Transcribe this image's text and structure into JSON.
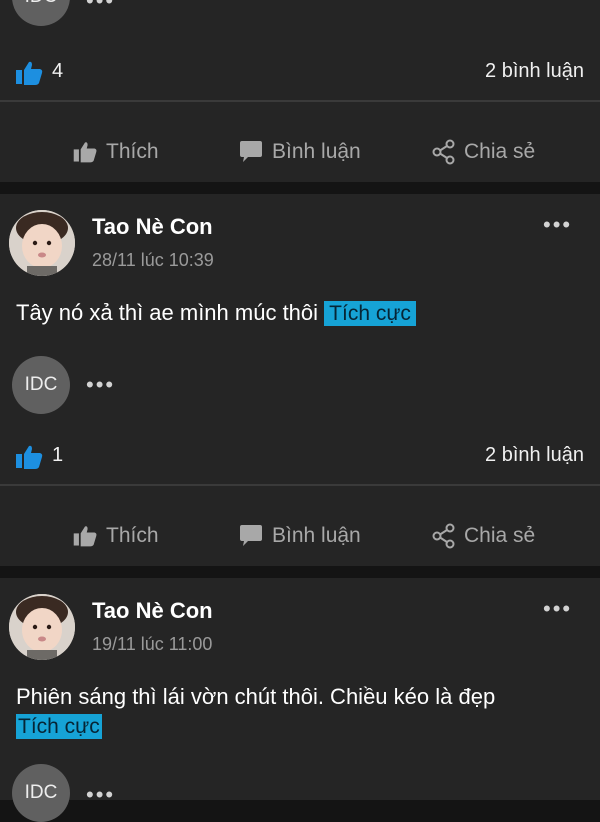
{
  "post0": {
    "avatar_text": "IDC",
    "likes": "4",
    "comments": "2 bình luận"
  },
  "actions": {
    "like": "Thích",
    "comment": "Bình luận",
    "share": "Chia sẻ"
  },
  "post1": {
    "author": "Tao Nè Con",
    "timestamp": "28/11 lúc 10:39",
    "text": "Tây nó xả thì ae mình múc thôi",
    "tag": "Tích cực",
    "commenter_avatar": "IDC",
    "likes": "1",
    "comments": "2 bình luận"
  },
  "post2": {
    "author": "Tao Nè Con",
    "timestamp": "19/11 lúc 11:00",
    "text": "Phiên sáng thì lái vờn chút thôi. Chiều kéo là đẹp",
    "tag": "Tích cực",
    "commenter_avatar": "IDC"
  },
  "colors": {
    "background": "#141414",
    "card": "#252525",
    "accent": "#16a3d6",
    "like_blue": "#1d8fe0"
  },
  "icons": {
    "like": "thumbs-up-icon",
    "comment": "speech-bubble-icon",
    "share": "share-icon",
    "more": "more-dots-icon"
  }
}
